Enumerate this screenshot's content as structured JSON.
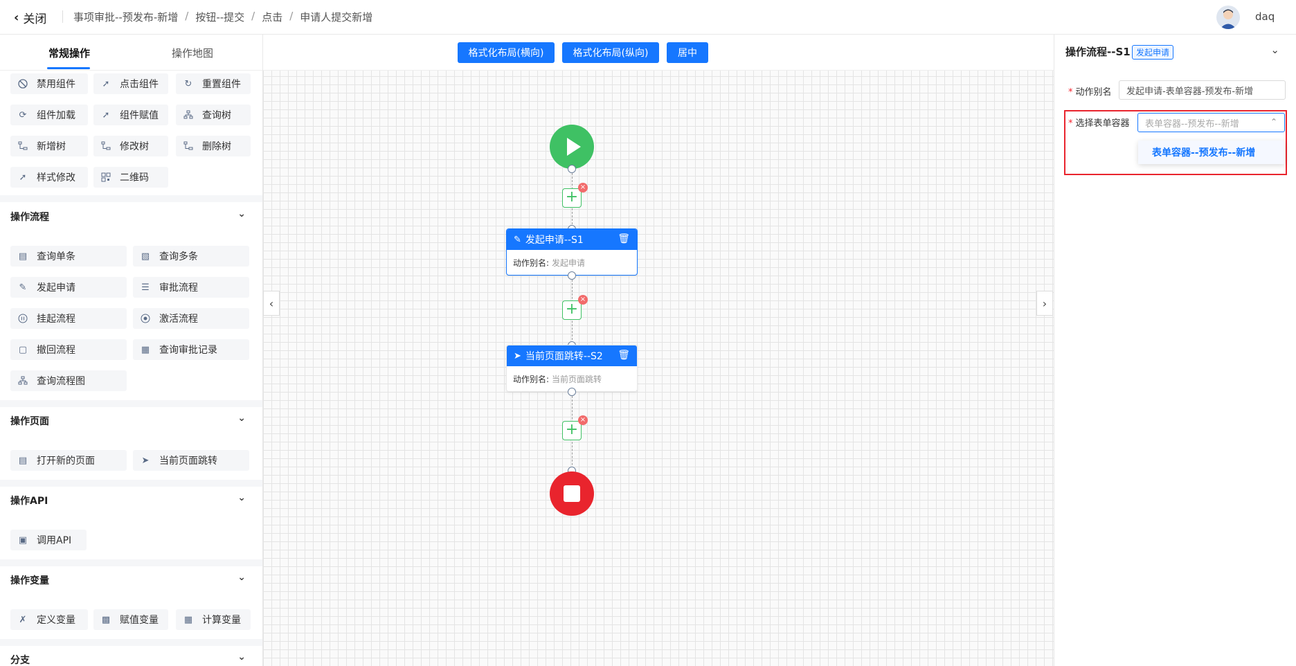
{
  "header": {
    "close_label": "关闭",
    "breadcrumb": [
      "事项审批--预发布-新增",
      "按钮--提交",
      "点击",
      "申请人提交新增"
    ],
    "separator": "/",
    "username": "daq"
  },
  "left_panel": {
    "tabs": [
      {
        "label": "常规操作",
        "active": true
      },
      {
        "label": "操作地图",
        "active": false
      }
    ],
    "common_items": [
      {
        "label": "禁用组件",
        "icon": "ban-icon"
      },
      {
        "label": "点击组件",
        "icon": "pointer-icon"
      },
      {
        "label": "重置组件",
        "icon": "reset-icon"
      },
      {
        "label": "组件加载",
        "icon": "refresh-icon"
      },
      {
        "label": "组件赋值",
        "icon": "pointer-icon"
      },
      {
        "label": "查询树",
        "icon": "tree-icon"
      },
      {
        "label": "新增树",
        "icon": "tree-add-icon"
      },
      {
        "label": "修改树",
        "icon": "tree-edit-icon"
      },
      {
        "label": "删除树",
        "icon": "tree-delete-icon"
      },
      {
        "label": "样式修改",
        "icon": "pointer-icon"
      },
      {
        "label": "二维码",
        "icon": "qrcode-icon"
      }
    ],
    "sections": [
      {
        "title": "操作流程",
        "items": [
          {
            "label": "查询单条",
            "icon": "query-one-icon"
          },
          {
            "label": "查询多条",
            "icon": "query-many-icon"
          },
          {
            "label": "发起申请",
            "icon": "apply-icon"
          },
          {
            "label": "审批流程",
            "icon": "approve-icon"
          },
          {
            "label": "挂起流程",
            "icon": "pause-icon"
          },
          {
            "label": "激活流程",
            "icon": "activate-icon"
          },
          {
            "label": "撤回流程",
            "icon": "withdraw-icon"
          },
          {
            "label": "查询审批记录",
            "icon": "record-icon"
          },
          {
            "label": "查询流程图",
            "icon": "flowchart-icon"
          }
        ]
      },
      {
        "title": "操作页面",
        "items": [
          {
            "label": "打开新的页面",
            "icon": "page-icon"
          },
          {
            "label": "当前页面跳转",
            "icon": "send-icon"
          }
        ]
      },
      {
        "title": "操作API",
        "items": [
          {
            "label": "调用API",
            "icon": "api-icon"
          }
        ]
      },
      {
        "title": "操作变量",
        "items": [
          {
            "label": "定义变量",
            "icon": "variable-icon"
          },
          {
            "label": "赋值变量",
            "icon": "assign-icon"
          },
          {
            "label": "计算变量",
            "icon": "calc-icon"
          }
        ]
      },
      {
        "title": "分支",
        "items": []
      }
    ]
  },
  "canvas": {
    "toolbar": [
      "格式化布局(横向)",
      "格式化布局(纵向)",
      "居中"
    ],
    "nodes": [
      {
        "title": "发起申请--S1",
        "alias_label": "动作别名:",
        "alias_value": "发起申请",
        "selected": true
      },
      {
        "title": "当前页面跳转--S2",
        "alias_label": "动作别名:",
        "alias_value": "当前页面跳转",
        "selected": false
      }
    ],
    "close_mark": "×",
    "add_mark": "+"
  },
  "right_panel": {
    "title": "操作流程--S1",
    "tag": "发起申请",
    "fields": {
      "alias": {
        "label": "动作别名",
        "value": "发起申请-表单容器-预发布-新增"
      },
      "form_container": {
        "label": "选择表单容器",
        "placeholder": "表单容器--预发布--新增",
        "options": [
          "表单容器--预发布--新增"
        ]
      }
    }
  },
  "colors": {
    "primary": "#1677ff",
    "start": "#3fc164",
    "end": "#e9242d",
    "highlight": "#e9242d"
  }
}
